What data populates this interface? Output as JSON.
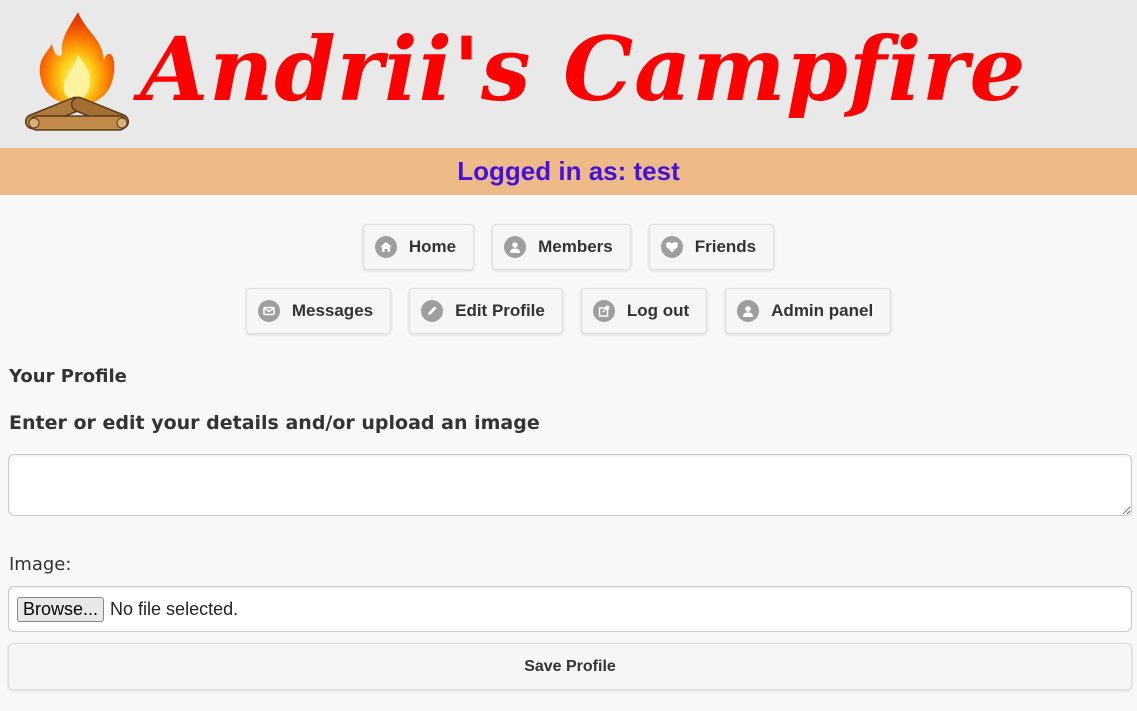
{
  "site": {
    "title": "Andrii's Campfire"
  },
  "status": {
    "text": "Logged in as: test"
  },
  "nav": {
    "row1": [
      {
        "label": "Home",
        "icon": "home-icon"
      },
      {
        "label": "Members",
        "icon": "user-icon"
      },
      {
        "label": "Friends",
        "icon": "heart-icon"
      }
    ],
    "row2": [
      {
        "label": "Messages",
        "icon": "mail-icon"
      },
      {
        "label": "Edit Profile",
        "icon": "pencil-icon"
      },
      {
        "label": "Log out",
        "icon": "logout-icon"
      },
      {
        "label": "Admin panel",
        "icon": "user-icon"
      }
    ]
  },
  "profile": {
    "heading": "Your Profile",
    "subheading": "Enter or edit your details and/or upload an image",
    "details_value": "",
    "image_label": "Image:",
    "browse_label": "Browse...",
    "file_status": "No file selected.",
    "save_label": "Save Profile"
  },
  "colors": {
    "title": "#ff0000",
    "status_bar": "#eebb88",
    "status_text": "#4411dd",
    "header_bg": "#e9e9e9"
  }
}
